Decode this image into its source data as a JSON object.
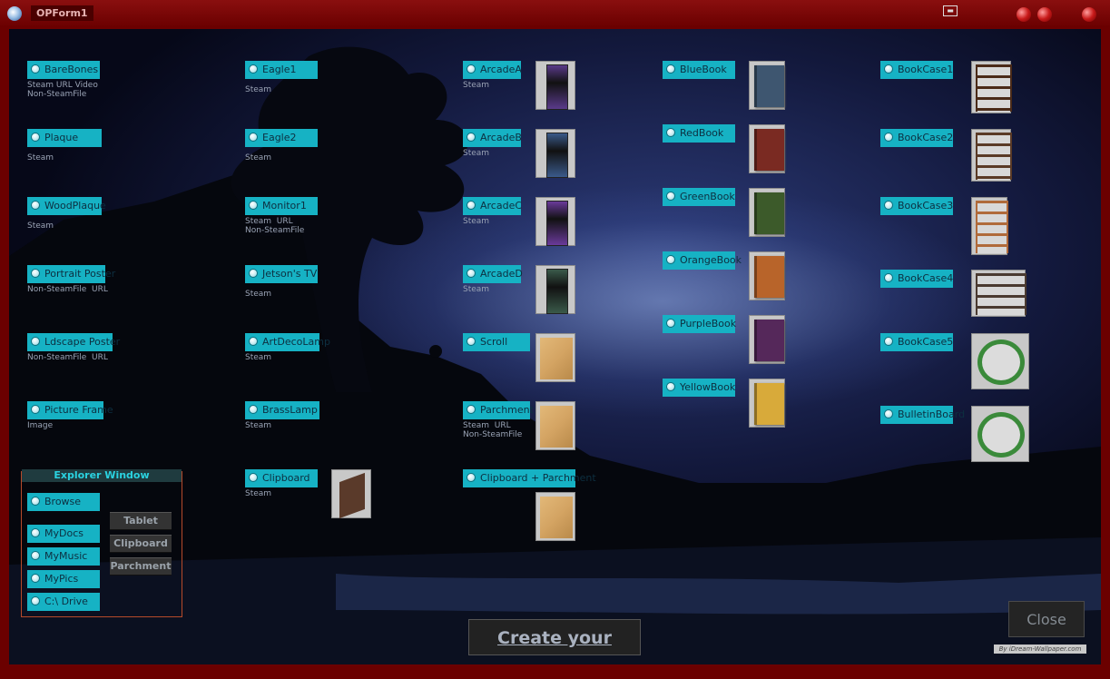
{
  "window": {
    "title": "OPForm1"
  },
  "options": [
    {
      "id": "barebones",
      "label": "BareBones",
      "sub": "Steam URL Video\nNon-SteamFile"
    },
    {
      "id": "plaque",
      "label": "Plaque",
      "sub": "Steam"
    },
    {
      "id": "woodplaque",
      "label": "WoodPlaque",
      "sub": "Steam"
    },
    {
      "id": "portrait",
      "label": "Portrait Poster",
      "sub": "Non-SteamFile  URL"
    },
    {
      "id": "ldscape",
      "label": "Ldscape Poster",
      "sub": "Non-SteamFile  URL"
    },
    {
      "id": "pictureframe",
      "label": "Picture Frame",
      "sub": "Image"
    },
    {
      "id": "eagle1",
      "label": "Eagle1",
      "sub": "Steam"
    },
    {
      "id": "eagle2",
      "label": "Eagle2",
      "sub": "Steam"
    },
    {
      "id": "monitor1",
      "label": "Monitor1",
      "sub": "Steam  URL\nNon-SteamFile"
    },
    {
      "id": "jetsons",
      "label": "Jetson's TV",
      "sub": "Steam"
    },
    {
      "id": "artdecolamp",
      "label": "ArtDecoLamp",
      "sub": "Steam"
    },
    {
      "id": "brasslamp",
      "label": "BrassLamp",
      "sub": "Steam"
    },
    {
      "id": "clipboard",
      "label": "Clipboard",
      "sub": "Steam"
    },
    {
      "id": "arcadea",
      "label": "ArcadeA",
      "sub": "Steam"
    },
    {
      "id": "arcadeb",
      "label": "ArcadeB",
      "sub": "Steam"
    },
    {
      "id": "arcadec",
      "label": "ArcadeC",
      "sub": "Steam"
    },
    {
      "id": "arcaded",
      "label": "ArcadeD",
      "sub": "Steam"
    },
    {
      "id": "scroll",
      "label": "Scroll",
      "sub": ""
    },
    {
      "id": "parchment",
      "label": "Parchment",
      "sub": "Steam  URL\nNon-SteamFile"
    },
    {
      "id": "clipparch",
      "label": "Clipboard + Parchment",
      "sub": ""
    },
    {
      "id": "bluebook",
      "label": "BlueBook",
      "sub": ""
    },
    {
      "id": "redbook",
      "label": "RedBook",
      "sub": ""
    },
    {
      "id": "greenbook",
      "label": "GreenBook",
      "sub": ""
    },
    {
      "id": "orangebook",
      "label": "OrangeBook",
      "sub": ""
    },
    {
      "id": "purplebook",
      "label": "PurpleBook",
      "sub": ""
    },
    {
      "id": "yellowbook",
      "label": "YellowBook",
      "sub": ""
    },
    {
      "id": "bookcase1",
      "label": "BookCase1",
      "sub": ""
    },
    {
      "id": "bookcase2",
      "label": "BookCase2",
      "sub": ""
    },
    {
      "id": "bookcase3",
      "label": "BookCase3",
      "sub": ""
    },
    {
      "id": "bookcase4",
      "label": "BookCase4",
      "sub": ""
    },
    {
      "id": "bookcase5",
      "label": "BookCase5",
      "sub": ""
    },
    {
      "id": "bulletinboard",
      "label": "BulletinBoard",
      "sub": ""
    }
  ],
  "thumbnails": [
    {
      "id": "arcadea",
      "icon": "arcade-cabinet",
      "color": "#5a3a8a"
    },
    {
      "id": "arcadeb",
      "icon": "arcade-cabinet",
      "color": "#3a5a8a"
    },
    {
      "id": "arcadec",
      "icon": "arcade-cabinet",
      "color": "#6a3a9a"
    },
    {
      "id": "arcaded",
      "icon": "arcade-cabinet",
      "color": "#3a5a4a"
    },
    {
      "id": "scroll",
      "icon": "parchment",
      "color": "#d4a463"
    },
    {
      "id": "parchment",
      "icon": "parchment",
      "color": "#d4a463"
    },
    {
      "id": "clipparch",
      "icon": "parchment",
      "color": "#d4a463"
    },
    {
      "id": "clipboard",
      "icon": "clipboard",
      "color": "#5a3a2a"
    },
    {
      "id": "bluebook",
      "icon": "book",
      "color": "#3e5670"
    },
    {
      "id": "redbook",
      "icon": "book",
      "color": "#7a2a22"
    },
    {
      "id": "greenbook",
      "icon": "book",
      "color": "#3c5a2a"
    },
    {
      "id": "orangebook",
      "icon": "book",
      "color": "#b8642a"
    },
    {
      "id": "purplebook",
      "icon": "book",
      "color": "#55285a"
    },
    {
      "id": "yellowbook",
      "icon": "book",
      "color": "#d8aa3a"
    },
    {
      "id": "bookcase1",
      "icon": "bookcase",
      "color": "#4a2a18"
    },
    {
      "id": "bookcase2",
      "icon": "bookcase",
      "color": "#5a3a26"
    },
    {
      "id": "bookcase3",
      "icon": "bookcase",
      "color": "#b06a3a"
    },
    {
      "id": "bookcase4",
      "icon": "bookcase",
      "color": "#4a3a30"
    },
    {
      "id": "bookcase5",
      "icon": "bulletin-ring",
      "color": "#3a8a3a"
    },
    {
      "id": "bulletinboard",
      "icon": "bulletin-ring",
      "color": "#3a8a3a"
    }
  ],
  "explorer": {
    "title": "Explorer Window",
    "options": [
      "Browse",
      "MyDocs",
      "MyMusic",
      "MyPics",
      "C:\\ Drive"
    ],
    "buttons": [
      "Tablet",
      "Clipboard",
      "Parchment"
    ]
  },
  "create_label": "Create your Object",
  "close_label": "Close",
  "credit": "By iDream-Wallpaper.com"
}
